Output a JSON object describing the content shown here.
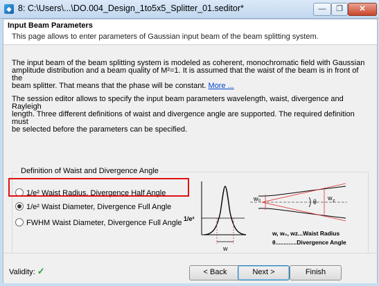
{
  "window": {
    "title": "8: C:\\Users\\...\\DO.004_Design_1to5x5_Splitter_01.seditor*",
    "minimize": "—",
    "maximize": "❐",
    "close": "✕"
  },
  "header": {
    "title": "Input Beam Parameters",
    "subtitle": "This page allows to enter parameters of Gaussian input beam of the beam splitting system."
  },
  "intro": {
    "line1": "The input beam of the beam splitting system is modeled as coherent, monochromatic field with Gaussian",
    "line2": "amplitude distribution and a beam quality of M²=1. It is assumed that the waist of the beam is in front of the",
    "line3": "beam splitter. That means that the phase will be constant.",
    "more_link": "More ..."
  },
  "session": {
    "line1": "The session editor allows to specify the input beam parameters wavelength, waist, divergence and Rayleigh",
    "line2": "length. Three different definitions of waist and divergence angle are supported. The required definition must",
    "line3": "be selected before the parameters can be specified."
  },
  "definition_group": {
    "label": "Definition of Waist and Divergence Angle",
    "options": [
      {
        "label": "1/e² Waist Radius, Divergence Half Angle",
        "selected": false
      },
      {
        "label": "1/e² Waist Diameter, Divergence Full Angle",
        "selected": true
      },
      {
        "label": "FWHM Waist Diameter, Divergence Full Angle",
        "selected": false
      }
    ]
  },
  "diagram": {
    "level_label": "1/e²",
    "w_label": "w",
    "w0_label": "w₀",
    "theta_label": "θ",
    "wz_label": "w",
    "wz_sub": "z",
    "legend_line1": "w, w₀, wz...Waist Radius",
    "legend_line2": "θ.............Divergence Angle",
    "curve_color": "#000000",
    "marker_color": "#e03030"
  },
  "footer": {
    "validity_label": "Validity:",
    "validity_icon": "✓",
    "back_label": "< Back",
    "next_label": "Next >",
    "finish_label": "Finish"
  }
}
